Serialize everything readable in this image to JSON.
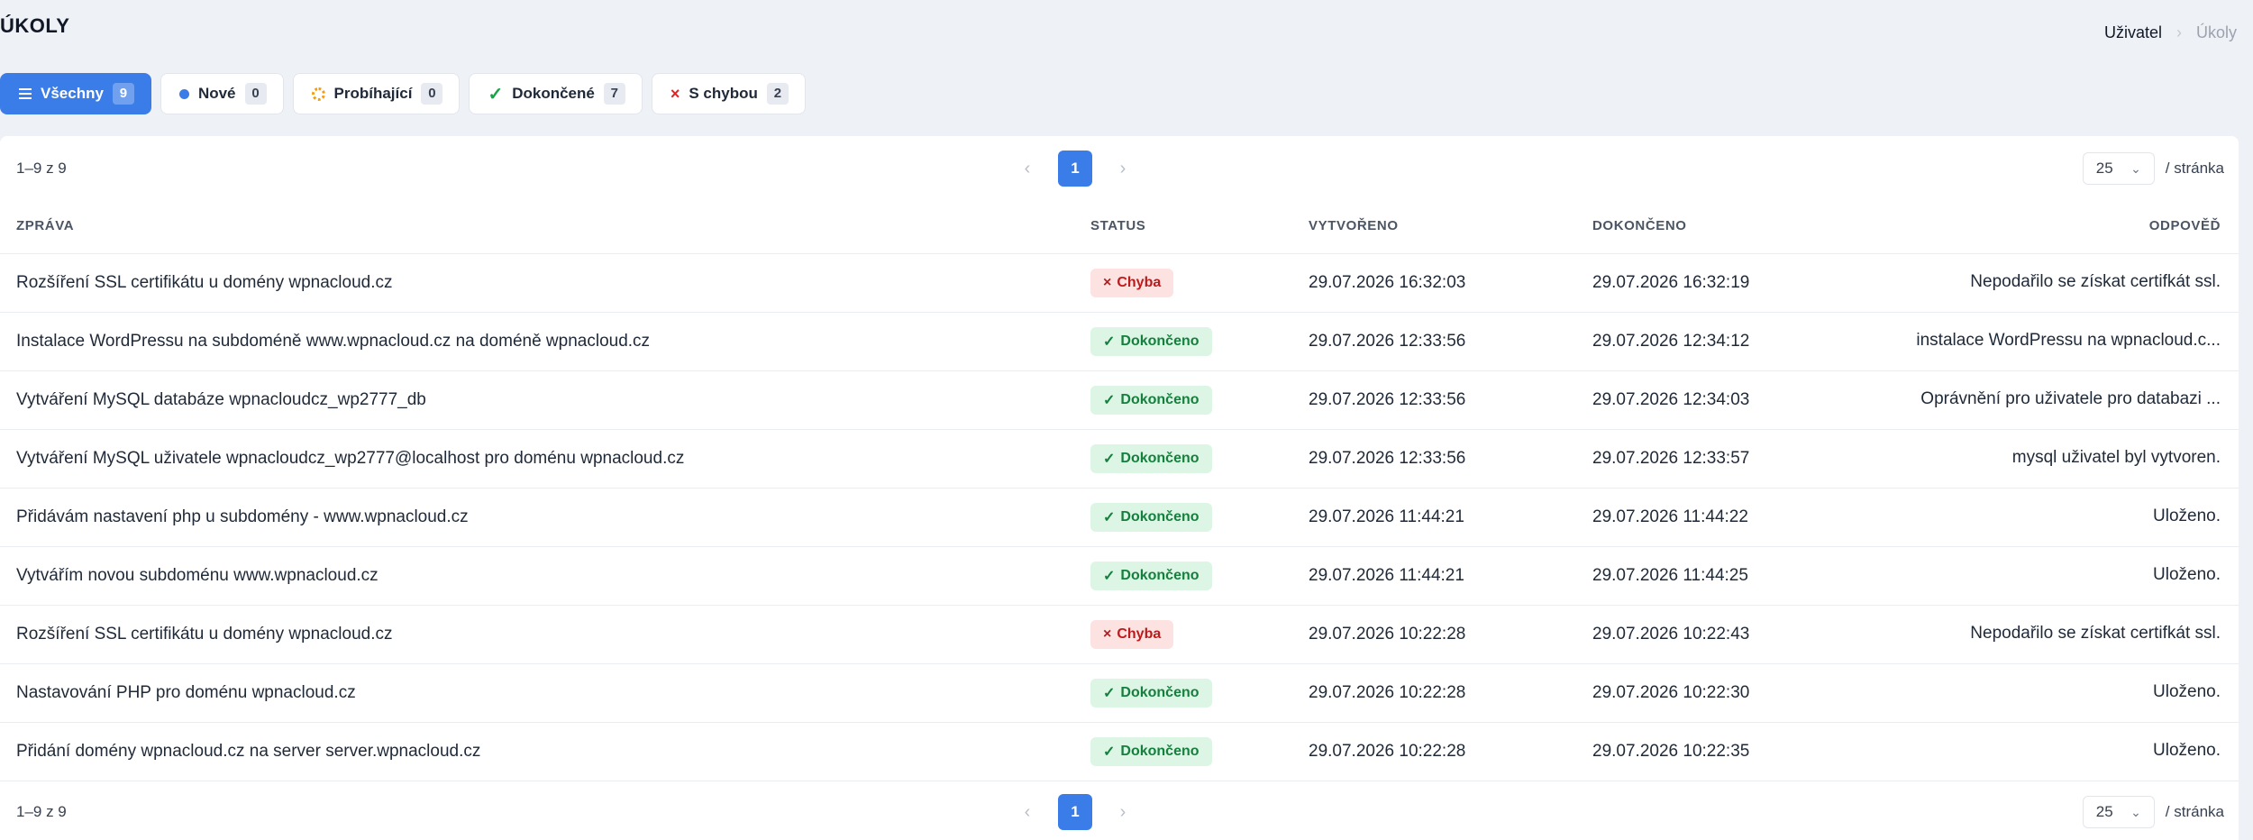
{
  "page": {
    "title": "ÚKOLY"
  },
  "breadcrumb": {
    "items": [
      "Uživatel",
      "Úkoly"
    ],
    "separator": "›"
  },
  "filters": [
    {
      "label": "Všechny",
      "count": "9",
      "icon": "list-icon",
      "active": true
    },
    {
      "label": "Nové",
      "count": "0",
      "icon": "blue-dot-icon"
    },
    {
      "label": "Probíhající",
      "count": "0",
      "icon": "spinner-icon"
    },
    {
      "label": "Dokončené",
      "count": "7",
      "icon": "check-icon"
    },
    {
      "label": "S chybou",
      "count": "2",
      "icon": "x-icon"
    }
  ],
  "pagination": {
    "range": "1–9 z 9",
    "current_page": "1",
    "prev": "‹",
    "next": "›",
    "per_page": "25",
    "per_page_suffix": "/ stránka"
  },
  "table": {
    "columns": [
      "ZPRÁVA",
      "STATUS",
      "VYTVOŘENO",
      "DOKONČENO",
      "ODPOVĚĎ"
    ],
    "rows": [
      {
        "message": "Rozšíření SSL certifikátu u domény wpnacloud.cz",
        "status": "Chyba",
        "status_type": "error",
        "created": "29.07.2026 16:32:03",
        "finished": "29.07.2026 16:32:19",
        "response": "Nepodařilo se získat certifkát ssl."
      },
      {
        "message": "Instalace WordPressu na subdoméně www.wpnacloud.cz na doméně wpnacloud.cz",
        "status": "Dokončeno",
        "status_type": "ok",
        "created": "29.07.2026 12:33:56",
        "finished": "29.07.2026 12:34:12",
        "response": "instalace WordPressu na wpnacloud.c..."
      },
      {
        "message": "Vytváření MySQL databáze wpnacloudcz_wp2777_db",
        "status": "Dokončeno",
        "status_type": "ok",
        "created": "29.07.2026 12:33:56",
        "finished": "29.07.2026 12:34:03",
        "response": "Oprávnění pro uživatele pro databazi ..."
      },
      {
        "message": "Vytváření MySQL uživatele wpnacloudcz_wp2777@localhost pro doménu wpnacloud.cz",
        "status": "Dokončeno",
        "status_type": "ok",
        "created": "29.07.2026 12:33:56",
        "finished": "29.07.2026 12:33:57",
        "response": "mysql uživatel byl vytvoren."
      },
      {
        "message": "Přidávám nastavení php u subdomény - www.wpnacloud.cz",
        "status": "Dokončeno",
        "status_type": "ok",
        "created": "29.07.2026 11:44:21",
        "finished": "29.07.2026 11:44:22",
        "response": "Uloženo."
      },
      {
        "message": "Vytvářím novou subdoménu www.wpnacloud.cz",
        "status": "Dokončeno",
        "status_type": "ok",
        "created": "29.07.2026 11:44:21",
        "finished": "29.07.2026 11:44:25",
        "response": "Uloženo."
      },
      {
        "message": "Rozšíření SSL certifikátu u domény wpnacloud.cz",
        "status": "Chyba",
        "status_type": "error",
        "created": "29.07.2026 10:22:28",
        "finished": "29.07.2026 10:22:43",
        "response": "Nepodařilo se získat certifkát ssl."
      },
      {
        "message": "Nastavování PHP pro doménu wpnacloud.cz",
        "status": "Dokončeno",
        "status_type": "ok",
        "created": "29.07.2026 10:22:28",
        "finished": "29.07.2026 10:22:30",
        "response": "Uloženo."
      },
      {
        "message": "Přidání domény wpnacloud.cz na server server.wpnacloud.cz",
        "status": "Dokončeno",
        "status_type": "ok",
        "created": "29.07.2026 10:22:28",
        "finished": "29.07.2026 10:22:35",
        "response": "Uloženo."
      }
    ]
  },
  "colors": {
    "accent": "#3b7de8",
    "error_bg": "#fde2e2",
    "error_fg": "#b91c1c",
    "ok_bg": "#dcf5e5",
    "ok_fg": "#15803d"
  }
}
